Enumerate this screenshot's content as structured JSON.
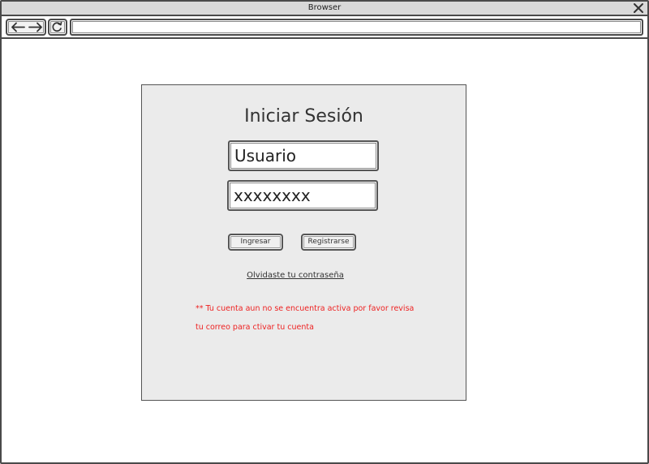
{
  "window": {
    "title": "Browser",
    "url": ""
  },
  "login": {
    "title": "Iniciar Sesión",
    "username_value": "Usuario",
    "password_value": "xxxxxxxx",
    "login_label": "Ingresar",
    "register_label": "Registrarse",
    "forgot_label": "Olvidaste tu contraseña",
    "warning_line1": "** Tu cuenta aun no se encuentra activa por favor revisa",
    "warning_line2": "tu correo para ctivar tu cuenta"
  },
  "colors": {
    "warning": "#ee2222",
    "panel_bg": "#ebebeb",
    "titlebar_bg": "#d9d9d9"
  },
  "icons": {
    "back": "arrow-left-icon",
    "forward": "arrow-right-icon",
    "reload": "reload-icon",
    "close": "close-icon"
  }
}
